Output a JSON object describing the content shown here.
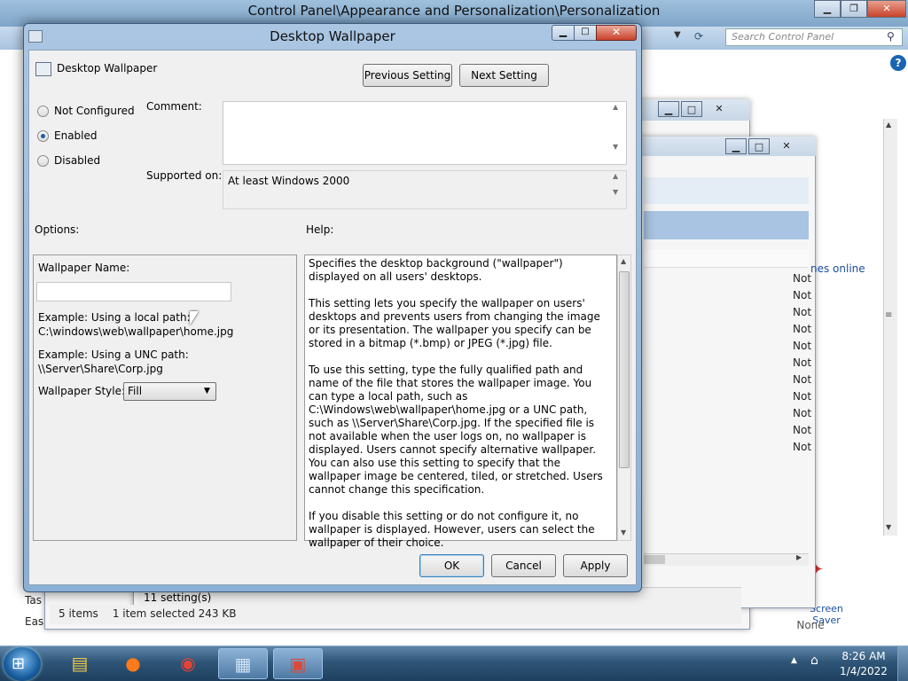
{
  "background_window": {
    "title": "Control Panel\\Appearance and Personalization\\Personalization",
    "search_placeholder": "Search Control Panel",
    "screen_saver_label": "Screen Saver",
    "screen_saver_value": "None",
    "left_tas": "Tas",
    "left_eas": "Eas"
  },
  "gp_list": {
    "online_link": "nes online",
    "state_abbrev": "Not",
    "settings_count": "11 setting(s)"
  },
  "status": {
    "items": "5 items",
    "selected": "1 item selected  243 KB"
  },
  "dialog": {
    "title": "Desktop Wallpaper",
    "policy_name": "Desktop Wallpaper",
    "prev_button": "Previous Setting",
    "next_button": "Next Setting",
    "radio": {
      "not_configured": "Not Configured",
      "enabled": "Enabled",
      "disabled": "Disabled"
    },
    "comment_label": "Comment:",
    "supported_label": "Supported on:",
    "supported_value": "At least Windows 2000",
    "options_label": "Options:",
    "help_label": "Help:",
    "wallpaper_name_label": "Wallpaper Name:",
    "wallpaper_name_value": "",
    "example_local_1": "Example: Using a local path:",
    "example_local_2": "C:\\windows\\web\\wallpaper\\home.jpg",
    "example_unc_1": "Example: Using a UNC path:",
    "example_unc_2": "\\\\Server\\Share\\Corp.jpg",
    "wallpaper_style_label": "Wallpaper Style:",
    "wallpaper_style_value": "Fill",
    "help_paragraphs": [
      "Specifies the desktop background (\"wallpaper\") displayed on all users' desktops.",
      "This setting lets you specify the wallpaper on users' desktops and prevents users from changing the image or its presentation. The wallpaper you specify can be stored in a bitmap (*.bmp) or JPEG (*.jpg) file.",
      "To use this setting, type the fully qualified path and name of the file that stores the wallpaper image. You can type a local path, such as C:\\Windows\\web\\wallpaper\\home.jpg or a UNC path, such as \\\\Server\\Share\\Corp.jpg. If the specified file is not available when the user logs on, no wallpaper is displayed. Users cannot specify alternative wallpaper. You can also use this setting to specify that the wallpaper image be centered, tiled, or stretched. Users cannot change this specification.",
      "If you disable this setting or do not configure it, no wallpaper is displayed. However, users can select the wallpaper of their choice."
    ],
    "ok_button": "OK",
    "cancel_button": "Cancel",
    "apply_button": "Apply"
  },
  "taskbar": {
    "time": "8:26 AM",
    "date": "1/4/2022",
    "items": [
      "explorer-icon",
      "firefox-icon",
      "chrome-icon",
      "control-panel-icon",
      "group-policy-icon"
    ]
  },
  "colors": {
    "accent": "#1f5fa8",
    "taskbar": "#2f5577",
    "close_red": "#c9412a"
  }
}
